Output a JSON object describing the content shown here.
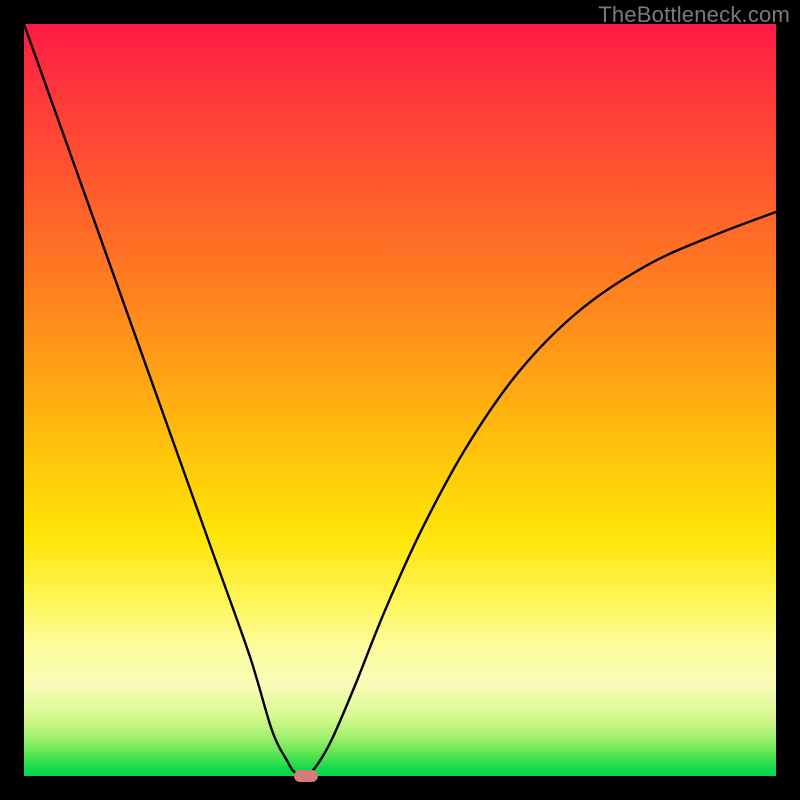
{
  "watermark": "TheBottleneck.com",
  "chart_data": {
    "type": "line",
    "title": "",
    "xlabel": "",
    "ylabel": "",
    "xlim": [
      0,
      100
    ],
    "ylim": [
      0,
      100
    ],
    "grid": false,
    "legend": false,
    "series": [
      {
        "name": "bottleneck-curve",
        "x": [
          0,
          5,
          10,
          15,
          20,
          25,
          30,
          33,
          35,
          36,
          37.5,
          39,
          41,
          44,
          48,
          53,
          59,
          66,
          74,
          83,
          92,
          100
        ],
        "values": [
          100,
          86,
          72,
          58,
          44,
          30,
          16,
          6,
          2,
          0.5,
          0,
          1.5,
          5,
          12,
          22,
          33,
          44,
          54,
          62,
          68,
          72,
          75
        ]
      }
    ],
    "optimum_marker": {
      "x": 37.5,
      "y": 0,
      "color": "#d77a7a"
    },
    "background_gradient": {
      "top": "#ff1a46",
      "bottom": "#00d84e"
    },
    "frame_color": "#000000"
  }
}
